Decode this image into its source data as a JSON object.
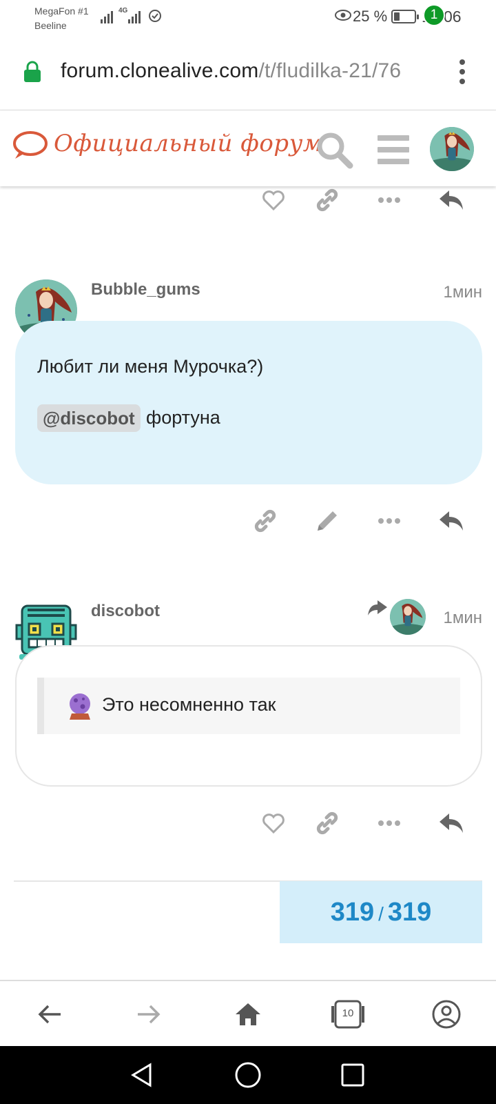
{
  "status_bar": {
    "carrier_1": "MegaFon #1",
    "carrier_2": "Beeline",
    "network": "4G",
    "battery": "25 %",
    "time": "19:06"
  },
  "browser": {
    "url_host": "forum.clonealive.com",
    "url_path": "/t/fludilka-21/76"
  },
  "forum_header": {
    "logo_text": "Официальный форум",
    "notification_count": "1"
  },
  "posts": [
    {
      "username": "Bubble_gums",
      "time": "1мин",
      "text_line_1": "Любит ли меня Мурочка?)",
      "mention": "@discobot",
      "mention_after": "фортуна"
    },
    {
      "username": "discobot",
      "time": "1мин",
      "quote": "Это несомненно так"
    }
  ],
  "progress": {
    "current": "319",
    "separator": "/",
    "total": "319"
  },
  "browser_nav": {
    "tabs_count": "10"
  },
  "colors": {
    "accent_blue": "#1e88c7",
    "bubble_bg": "#e0f3fb",
    "logo_red": "#d9593a",
    "notif_green": "#0e9a27"
  }
}
